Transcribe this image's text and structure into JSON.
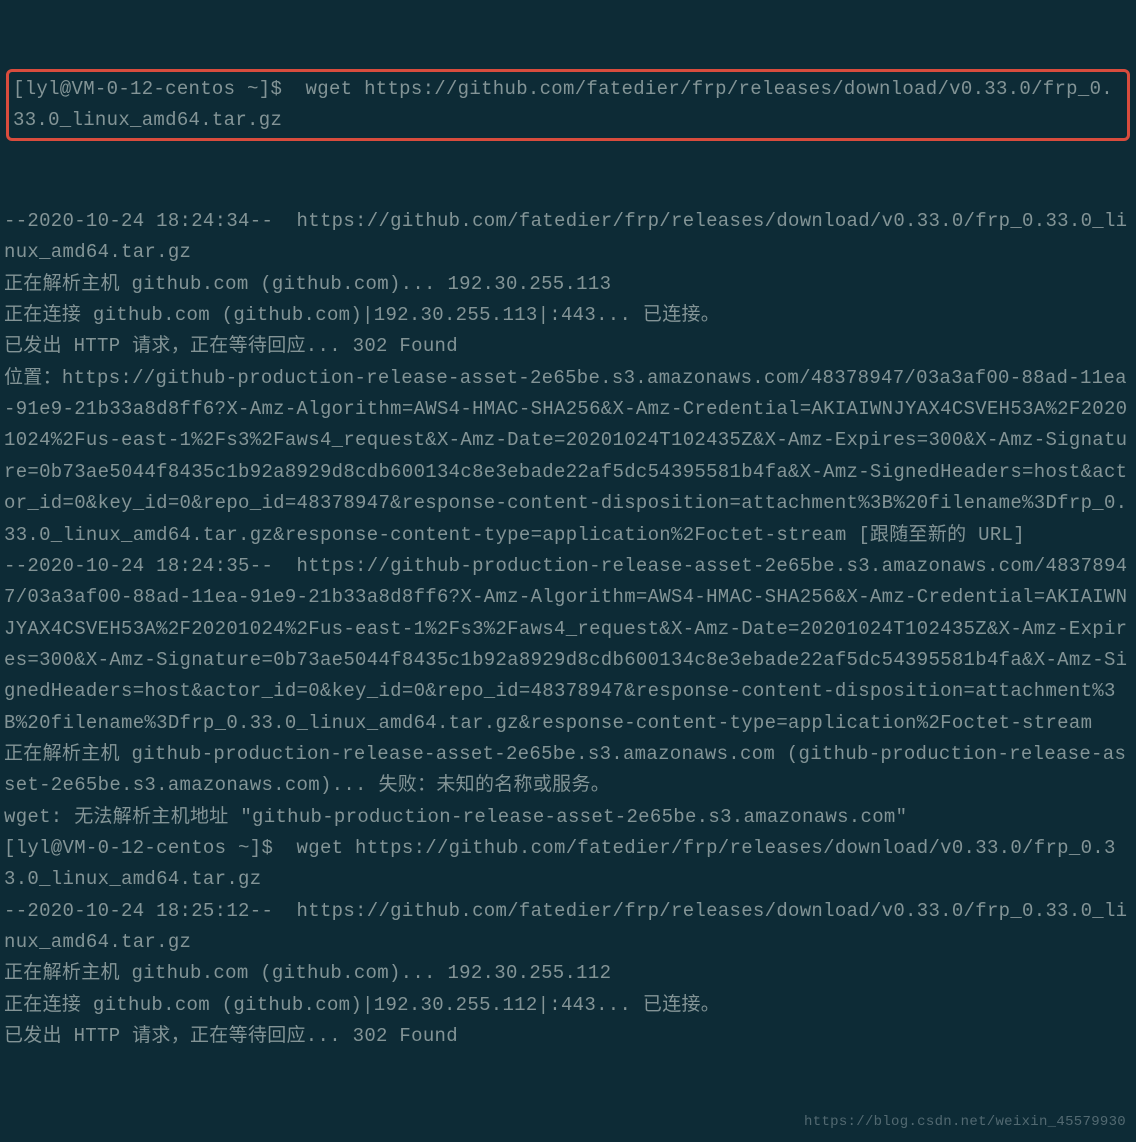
{
  "highlighted": {
    "prompt": "[lyl@VM-0-12-centos ~]$ ",
    "command": " wget https://github.com/fatedier/frp/releases/download/v0.33.0/frp_0.33.0_linux_amd64.tar.gz"
  },
  "output_lines": [
    "--2020-10-24 18:24:34--  https://github.com/fatedier/frp/releases/download/v0.33.0/frp_0.33.0_linux_amd64.tar.gz",
    "正在解析主机 github.com (github.com)... 192.30.255.113",
    "正在连接 github.com (github.com)|192.30.255.113|:443... 已连接。",
    "已发出 HTTP 请求，正在等待回应... 302 Found",
    "位置：https://github-production-release-asset-2e65be.s3.amazonaws.com/48378947/03a3af00-88ad-11ea-91e9-21b33a8d8ff6?X-Amz-Algorithm=AWS4-HMAC-SHA256&X-Amz-Credential=AKIAIWNJYAX4CSVEH53A%2F20201024%2Fus-east-1%2Fs3%2Faws4_request&X-Amz-Date=20201024T102435Z&X-Amz-Expires=300&X-Amz-Signature=0b73ae5044f8435c1b92a8929d8cdb600134c8e3ebade22af5dc54395581b4fa&X-Amz-SignedHeaders=host&actor_id=0&key_id=0&repo_id=48378947&response-content-disposition=attachment%3B%20filename%3Dfrp_0.33.0_linux_amd64.tar.gz&response-content-type=application%2Foctet-stream [跟随至新的 URL]",
    "--2020-10-24 18:24:35--  https://github-production-release-asset-2e65be.s3.amazonaws.com/48378947/03a3af00-88ad-11ea-91e9-21b33a8d8ff6?X-Amz-Algorithm=AWS4-HMAC-SHA256&X-Amz-Credential=AKIAIWNJYAX4CSVEH53A%2F20201024%2Fus-east-1%2Fs3%2Faws4_request&X-Amz-Date=20201024T102435Z&X-Amz-Expires=300&X-Amz-Signature=0b73ae5044f8435c1b92a8929d8cdb600134c8e3ebade22af5dc54395581b4fa&X-Amz-SignedHeaders=host&actor_id=0&key_id=0&repo_id=48378947&response-content-disposition=attachment%3B%20filename%3Dfrp_0.33.0_linux_amd64.tar.gz&response-content-type=application%2Foctet-stream",
    "正在解析主机 github-production-release-asset-2e65be.s3.amazonaws.com (github-production-release-asset-2e65be.s3.amazonaws.com)... 失败：未知的名称或服务。",
    "wget: 无法解析主机地址 \"github-production-release-asset-2e65be.s3.amazonaws.com\"",
    "[lyl@VM-0-12-centos ~]$  wget https://github.com/fatedier/frp/releases/download/v0.33.0/frp_0.33.0_linux_amd64.tar.gz",
    "--2020-10-24 18:25:12--  https://github.com/fatedier/frp/releases/download/v0.33.0/frp_0.33.0_linux_amd64.tar.gz",
    "正在解析主机 github.com (github.com)... 192.30.255.112",
    "正在连接 github.com (github.com)|192.30.255.112|:443... 已连接。",
    "已发出 HTTP 请求，正在等待回应... 302 Found"
  ],
  "watermark": "https://blog.csdn.net/weixin_45579930"
}
